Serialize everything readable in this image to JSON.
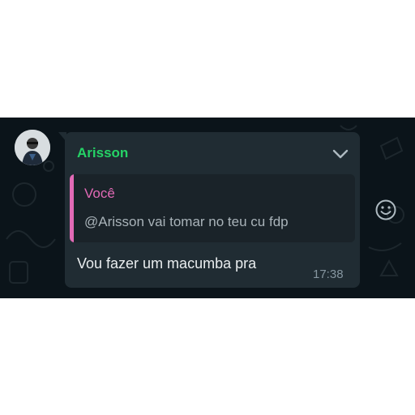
{
  "message": {
    "sender": "Arisson",
    "sender_color": "#25d366",
    "quoted": {
      "author": "Você",
      "author_color": "#e26ab6",
      "text": "@Arisson vai tomar no teu cu fdp"
    },
    "text": "Vou fazer um macumba pra",
    "time": "17:38"
  },
  "icons": {
    "menu": "chevron-down-icon",
    "react": "emoji-smile-icon",
    "avatar": "contact-avatar"
  },
  "colors": {
    "chat_background": "#0b141a",
    "bubble": "#202c33",
    "quote_background": "#1a2329"
  }
}
